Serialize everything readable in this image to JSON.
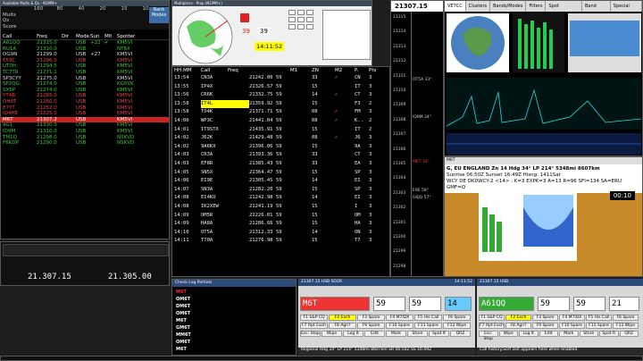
{
  "bandmap": {
    "title": "Available Mults & Qs - N1MM+",
    "header_rows": [
      [
        "",
        "160",
        "80",
        "40",
        "20",
        "15",
        "10"
      ],
      [
        "Mults",
        "",
        "",
        "",
        "",
        "",
        ""
      ],
      [
        "Qs",
        "",
        "",
        "",
        "",
        "",
        ""
      ],
      [
        "Score",
        "",
        "",
        "",
        "",
        "",
        ""
      ]
    ],
    "rank_button": "Rank Modes",
    "columns": [
      "Call",
      "Freq",
      "Dir",
      "Mode",
      "Sun",
      "Mlt",
      "Spotter"
    ],
    "rows": [
      {
        "call": "A61QQ",
        "freq": "21315.0",
        "dir": "",
        "mode": "USB",
        "sun": "+22",
        "mlt": "✔",
        "spotter": "KM5VI",
        "color": "#3c3"
      },
      {
        "call": "RU1A",
        "freq": "21310.0",
        "dir": "",
        "mode": "USB",
        "sun": "",
        "mlt": "",
        "spotter": "NT6X",
        "color": "#3c3"
      },
      {
        "call": "OG9N",
        "freq": "21299.0",
        "dir": "",
        "mode": "USB",
        "sun": "+27",
        "mlt": "",
        "spotter": "KM5VI",
        "color": "#ddd"
      },
      {
        "call": "E59C",
        "freq": "21296.0",
        "dir": "",
        "mode": "USB",
        "sun": "",
        "mlt": "",
        "spotter": "KM5VI",
        "color": "#e44"
      },
      {
        "call": "UT0H",
        "freq": "21294.5",
        "dir": "",
        "mode": "USB",
        "sun": "",
        "mlt": "",
        "spotter": "KM5VI",
        "color": "#3c3"
      },
      {
        "call": "TC7TR",
        "freq": "21271.1",
        "dir": "",
        "mode": "USB",
        "sun": "",
        "mlt": "",
        "spotter": "KM5VI",
        "color": "#3c3"
      },
      {
        "call": "SP3CYY",
        "freq": "21275.0",
        "dir": "",
        "mode": "USB",
        "sun": "",
        "mlt": "",
        "spotter": "KM5VI",
        "color": "#ddd"
      },
      {
        "call": "SP2QG",
        "freq": "21274.0",
        "dir": "",
        "mode": "USB",
        "sun": "",
        "mlt": "",
        "spotter": "KG5VK",
        "color": "#3c3"
      },
      {
        "call": "SX5P",
        "freq": "21274.0",
        "dir": "",
        "mode": "USB",
        "sun": "",
        "mlt": "",
        "spotter": "KM5VI",
        "color": "#3c3"
      },
      {
        "call": "YT4B",
        "freq": "21265.0",
        "dir": "",
        "mode": "USB",
        "sun": "",
        "mlt": "",
        "spotter": "KM5VI",
        "color": "#e44"
      },
      {
        "call": "OH0T",
        "freq": "21260.0",
        "dir": "",
        "mode": "USB",
        "sun": "",
        "mlt": "",
        "spotter": "KM5VI",
        "color": "#e44"
      },
      {
        "call": "E7YT",
        "freq": "21252.0",
        "dir": "",
        "mode": "USB",
        "sun": "",
        "mlt": "",
        "spotter": "KM5VI",
        "color": "#e44"
      },
      {
        "call": "IO4HE",
        "freq": "21225.0",
        "dir": "",
        "mode": "USB",
        "sun": "",
        "mlt": "",
        "spotter": "KM5VI",
        "color": "#e44"
      },
      {
        "call": "M6T",
        "freq": "21307.2",
        "dir": "",
        "mode": "USB",
        "sun": "",
        "mlt": "",
        "spotter": "KM5VI",
        "color": "#fff",
        "selected": true
      },
      {
        "call": "9G1",
        "freq": "21330.0",
        "dir": "",
        "mode": "USB",
        "sun": "",
        "mlt": "",
        "spotter": "KM5VI",
        "color": "#3c3"
      },
      {
        "call": "IO9M",
        "freq": "21310.0",
        "dir": "",
        "mode": "USB",
        "sun": "",
        "mlt": "",
        "spotter": "KM5VI",
        "color": "#3c3"
      },
      {
        "call": "TM1Q",
        "freq": "21298.0",
        "dir": "",
        "mode": "USB",
        "sun": "",
        "mlt": "",
        "spotter": "N5KVD",
        "color": "#3c3"
      },
      {
        "call": "F6KDP",
        "freq": "21290.0",
        "dir": "",
        "mode": "USB",
        "sun": "",
        "mlt": "",
        "spotter": "N5KVD",
        "color": "#3c3"
      }
    ]
  },
  "rig": {
    "freq_a": "21.307.15",
    "freq_b": "21.305.00"
  },
  "mapwin": {
    "title": "Multipliers - Prop (N1MM+)",
    "call": "39",
    "qsos": "39",
    "time": "14:11:52",
    "rate_label": "Rate"
  },
  "log": {
    "columns": [
      "HH:MM",
      "Call",
      "Freq",
      "",
      "M1",
      "ZN",
      "M2",
      "P.",
      "Pts"
    ],
    "rows": [
      {
        "t": "13:54",
        "call": "CN3A",
        "freq": "21242.00",
        "s": "59",
        "m1": "",
        "zn": "33",
        "m2": "✔",
        "p": "CN",
        "pts": "3"
      },
      {
        "t": "13:55",
        "call": "IP4X",
        "freq": "21326.57",
        "s": "59",
        "m1": "",
        "zn": "15",
        "m2": "",
        "p": "IT",
        "pts": "3"
      },
      {
        "t": "13:56",
        "call": "CR6K",
        "freq": "21332.75",
        "s": "59",
        "m1": "",
        "zn": "14",
        "m2": "✔",
        "p": "CT",
        "pts": "3"
      },
      {
        "t": "13:58",
        "call": "IT4L",
        "freq": "21359.92",
        "s": "59",
        "m1": "",
        "zn": "15",
        "m2": "",
        "p": "F3",
        "pts": "2",
        "hl": true
      },
      {
        "t": "13:58",
        "call": "TO4K",
        "freq": "21371.71",
        "s": "59",
        "m1": "",
        "zn": "08",
        "m2": "✔",
        "p": "FM",
        "pts": "3"
      },
      {
        "t": "14:00",
        "call": "WP3C",
        "freq": "21441.04",
        "s": "59",
        "m1": "",
        "zn": "08",
        "m2": "✔",
        "p": "K..",
        "pts": "2"
      },
      {
        "t": "14:01",
        "call": "IT9STX",
        "freq": "21435.91",
        "s": "59",
        "m1": "",
        "zn": "15",
        "m2": "",
        "p": "IT",
        "pts": "2"
      },
      {
        "t": "14:02",
        "call": "J62K",
        "freq": "21429.48",
        "s": "59",
        "m1": "",
        "zn": "08",
        "m2": "✔",
        "p": "J6",
        "pts": "3"
      },
      {
        "t": "14:02",
        "call": "9A6KX",
        "freq": "21396.06",
        "s": "59",
        "m1": "",
        "zn": "15",
        "m2": "",
        "p": "9A",
        "pts": "3"
      },
      {
        "t": "14:03",
        "call": "CR3A",
        "freq": "21393.36",
        "s": "59",
        "m1": "",
        "zn": "33",
        "m2": "",
        "p": "CT",
        "pts": "3"
      },
      {
        "t": "14:03",
        "call": "EF8R",
        "freq": "21385.43",
        "s": "59",
        "m1": "",
        "zn": "33",
        "m2": "",
        "p": "EA",
        "pts": "3"
      },
      {
        "t": "14:05",
        "call": "SN5X",
        "freq": "21364.47",
        "s": "59",
        "m1": "",
        "zn": "15",
        "m2": "",
        "p": "SP",
        "pts": "3"
      },
      {
        "t": "14:06",
        "call": "EI9E",
        "freq": "21305.45",
        "s": "59",
        "m1": "",
        "zn": "14",
        "m2": "",
        "p": "EI",
        "pts": "3"
      },
      {
        "t": "14:07",
        "call": "SN3A",
        "freq": "21282.20",
        "s": "59",
        "m1": "",
        "zn": "15",
        "m2": "",
        "p": "SP",
        "pts": "3"
      },
      {
        "t": "14:08",
        "call": "EI4KU",
        "freq": "21242.98",
        "s": "59",
        "m1": "",
        "zn": "14",
        "m2": "",
        "p": "EI",
        "pts": "3"
      },
      {
        "t": "14:08",
        "call": "IK2XEW",
        "freq": "21241.19",
        "s": "59",
        "m1": "",
        "zn": "15",
        "m2": "",
        "p": "I",
        "pts": "3"
      },
      {
        "t": "14:09",
        "call": "OM5R",
        "freq": "21226.01",
        "s": "59",
        "m1": "",
        "zn": "15",
        "m2": "",
        "p": "OM",
        "pts": "3"
      },
      {
        "t": "14:09",
        "call": "HA8A",
        "freq": "21286.66",
        "s": "59",
        "m1": "",
        "zn": "15",
        "m2": "",
        "p": "HA",
        "pts": "3"
      },
      {
        "t": "14:10",
        "call": "OT5A",
        "freq": "21312.33",
        "s": "59",
        "m1": "",
        "zn": "14",
        "m2": "",
        "p": "ON",
        "pts": "3"
      },
      {
        "t": "14:11",
        "call": "T70A",
        "freq": "21276.98",
        "s": "59",
        "m1": "",
        "zn": "15",
        "m2": "",
        "p": "T7",
        "pts": "3"
      }
    ]
  },
  "scale": {
    "freq": "21307.15",
    "ticks": [
      "21315",
      "21314",
      "21313",
      "21312",
      "21311",
      "21310",
      "21309",
      "21308",
      "21307",
      "21306",
      "21305",
      "21304",
      "21303",
      "21302",
      "21301",
      "21300",
      "21299",
      "21298"
    ],
    "spots": [
      {
        "call": "OT5A 33°",
        "color": "#cfcfcf"
      },
      {
        "call": "IO9M 34°",
        "color": "#cfcfcf"
      },
      {
        "call": "M6T 34°",
        "color": "#e33"
      },
      {
        "call": "E9E 58°",
        "color": "#cfcfcf"
      },
      {
        "call": "G6JQ 57°",
        "color": "#cfcfcf"
      }
    ]
  },
  "cluster": {
    "tabs": [
      "VE7CC",
      "Clusters",
      "Bands/Modes",
      "Filters",
      "Spot Comment",
      "Band Plans",
      "Special Calls"
    ]
  },
  "info": {
    "line1": "G, EU ENGLAND Zn 14 Hdg 34° LP 214° 5348mi 8607km",
    "line2": "Sunrise 06:50Z Sunset 16:49Z Hisng: 1411Sat",
    "line3": "WCY DE DK0WCY-2 <14> : K=3 EXPK=3 A=13 R=96 SFI=134 SA=ERU GMF=Q",
    "timer": "00:10"
  },
  "entry1": {
    "title": "21307.15 USB SO2R",
    "time": "14:11:52",
    "call": "M6T",
    "rst_s": "59",
    "rst_r": "59",
    "zone": "14",
    "fkeys": [
      "F1 S&P CQ",
      "F2 Exch",
      "F3 Spare",
      "F4 M7IDX",
      "F5 His Call",
      "F6 Spare",
      "F7 Rpt Exch",
      "F8 Agn?",
      "F9 Spare",
      "F10 Spare",
      "F11 Spare",
      "F12 Wipe",
      "Esc: Stop",
      "Wipe",
      "Log It",
      "Edit",
      "Mark",
      "Store",
      "Spot It",
      "QRZ"
    ],
    "status": "Regional Hdg 34° LP 214° 5348mi 8607km SR 06:50Z SS 16:49Z"
  },
  "entry2": {
    "title": "21307.15 USB",
    "call": "A61QQ",
    "rst_s": "59",
    "rst_r": "59",
    "zone": "21",
    "fkeys": [
      "F1 S&P CQ",
      "F2 Exch",
      "F3 Spare",
      "F4 M7IDX",
      "F5 His Call",
      "F6 Spare",
      "F7 Rpt Exch",
      "F8 Agn?",
      "F9 Spare",
      "F10 Spare",
      "F11 Spare",
      "F12 Wipe",
      "Esc: Stop",
      "Wipe",
      "Log It",
      "Edit",
      "Mark",
      "Store",
      "Spot It",
      "QRZ"
    ],
    "status": "Call history.Sort last appears here when enabled."
  },
  "checkwin": {
    "title": "Check Log Partials",
    "calls": [
      "M6T",
      "OM6T",
      "DM6T",
      "OM6T",
      "M6T",
      "GM6T",
      "MM6T",
      "OM6T",
      "M6T"
    ]
  }
}
